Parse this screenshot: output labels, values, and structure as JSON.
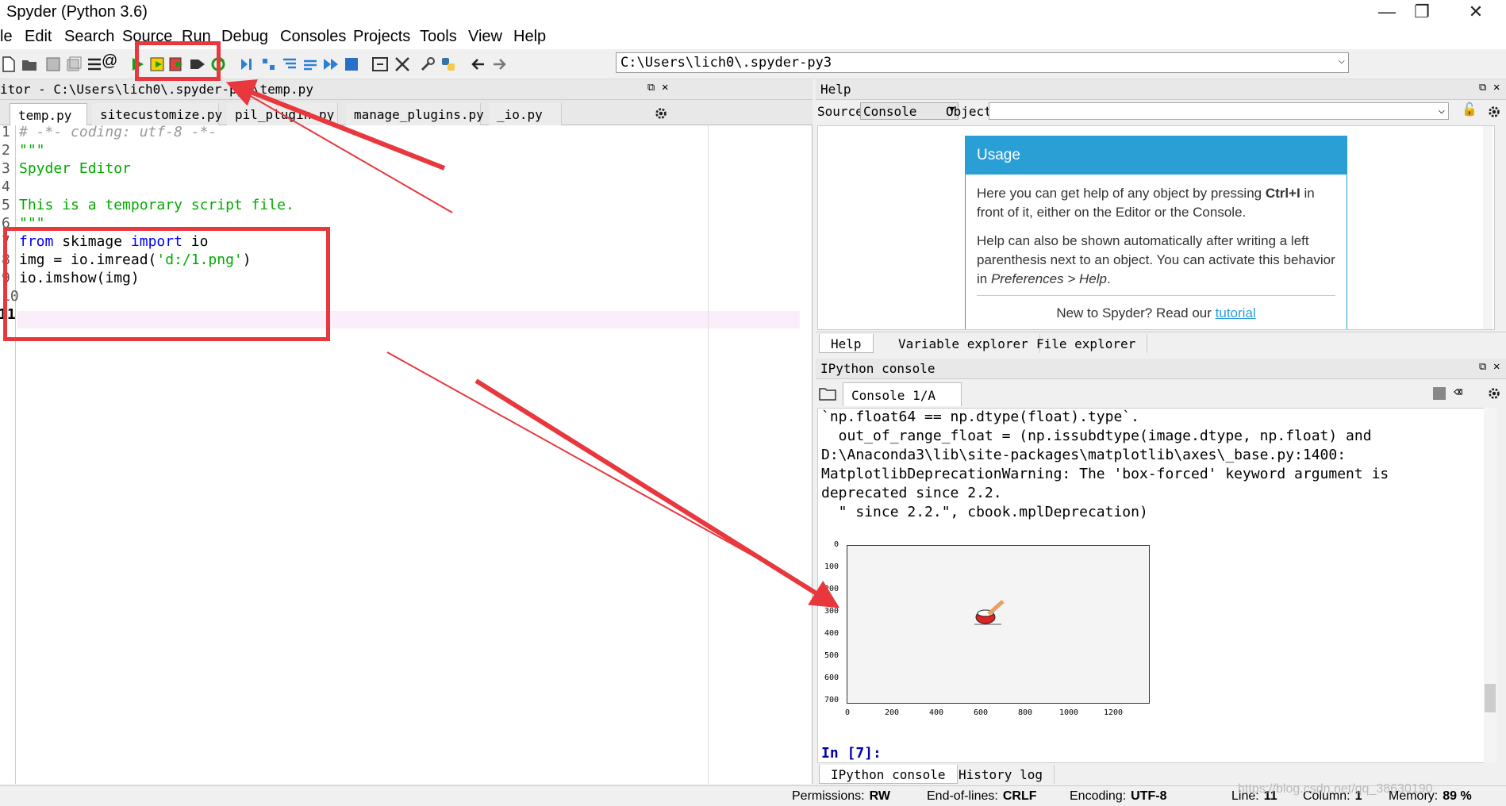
{
  "window": {
    "title": "Spyder (Python 3.6)",
    "minimize": "—",
    "maximize": "❐",
    "close": "✕"
  },
  "menu": [
    "le",
    "Edit",
    "Search",
    "Source",
    "Run",
    "Debug",
    "Consoles",
    "Projects",
    "Tools",
    "View",
    "Help"
  ],
  "toolbar": {
    "path": "C:\\Users\\lich0\\.spyder-py3"
  },
  "editor": {
    "header": "itor - C:\\Users\\lich0\\.spyder-py3\\temp.py",
    "tabs": [
      "temp.py",
      "sitecustomize.py",
      "pil_plugin.py",
      "manage_plugins.py",
      "_io.py"
    ],
    "lines": {
      "n1": "1",
      "n2": "2",
      "n3": "3",
      "n4": "4",
      "n5": "5",
      "n6": "6",
      "n7": "7",
      "n8": "8",
      "n9": "9",
      "n10": "10",
      "n11": "11",
      "l1": "# -*- coding: utf-8 -*-",
      "l2": "\"\"\"",
      "l3": "Spyder Editor",
      "l5": "This is a temporary script file.",
      "l6": "\"\"\"",
      "l7_kw1": "from",
      "l7_mid": " skimage ",
      "l7_kw2": "import",
      "l7_end": " io",
      "l8_a": "img = io.imread(",
      "l8_s": "'d:/1.png'",
      "l8_b": ")",
      "l9": "io.imshow(img)"
    }
  },
  "help": {
    "header": "Help",
    "source_label": "Source",
    "source_value": "Console",
    "object_label": "Object",
    "usage_title": "Usage",
    "usage_p1a": "Here you can get help of any object by pressing ",
    "usage_p1b": "Ctrl+I",
    "usage_p1c": " in front of it, either on the Editor or the Console.",
    "usage_p2a": "Help can also be shown automatically after writing a left parenthesis next to an object. You can activate this behavior in ",
    "usage_p2b": "Preferences > Help",
    "usage_p2c": ".",
    "usage_p3a": "New to Spyder? Read our ",
    "usage_p3b": "tutorial",
    "tabs": [
      "Help",
      "Variable explorer",
      "File explorer"
    ]
  },
  "console": {
    "header": "IPython console",
    "tab": "Console 1/A",
    "lines": [
      "`np.float64 == np.dtype(float).type`.",
      "  out_of_range_float = (np.issubdtype(image.dtype, np.float) and",
      "D:\\Anaconda3\\lib\\site-packages\\matplotlib\\axes\\_base.py:1400:",
      "MatplotlibDeprecationWarning: The 'box-forced' keyword argument is",
      "deprecated since 2.2.",
      "  \" since 2.2.\", cbook.mplDeprecation)"
    ],
    "prompt": "In [7]:",
    "plot": {
      "yticks": [
        "0",
        "100",
        "200",
        "300",
        "400",
        "500",
        "600",
        "700"
      ],
      "xticks": [
        "0",
        "200",
        "400",
        "600",
        "800",
        "1000",
        "1200"
      ]
    },
    "tabs": [
      "IPython console",
      "History log"
    ]
  },
  "status": {
    "permissions_label": "Permissions:",
    "permissions": "RW",
    "eol_label": "End-of-lines:",
    "eol": "CRLF",
    "encoding_label": "Encoding:",
    "encoding": "UTF-8",
    "line_label": "Line:",
    "line": "11",
    "column_label": "Column:",
    "column": "1",
    "memory_label": "Memory:",
    "memory": "89 %"
  },
  "watermark": "https://blog.csdn.net/qq_38630190",
  "colors": {
    "annotation_red": "#e8383d",
    "usage_blue": "#2a9fd6"
  }
}
